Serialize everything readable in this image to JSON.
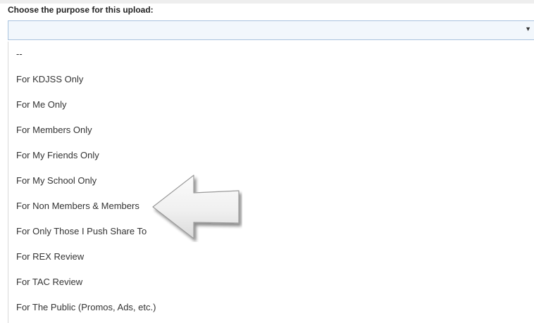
{
  "form": {
    "label": "Choose the purpose for this upload:",
    "select_value": "",
    "arrow_icon": "chevron-down-icon"
  },
  "dropdown": {
    "options": [
      "--",
      "For KDJSS Only",
      "For Me Only",
      "For Members Only",
      "For My Friends Only",
      "For My School Only",
      "For Non Members & Members",
      "For Only Those I Push Share To",
      "For REX Review",
      "For TAC Review",
      "For The Public (Promos, Ads, etc.)"
    ]
  },
  "annotation": {
    "icon": "left-arrow-icon",
    "points_to": "For Non Members & Members"
  }
}
